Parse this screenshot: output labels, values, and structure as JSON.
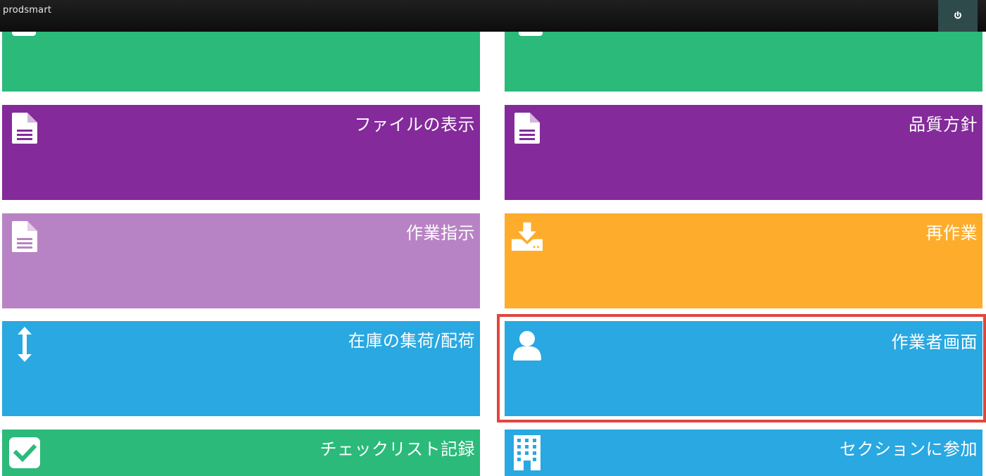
{
  "header": {
    "brand": "prodsmart",
    "power_icon": "power-icon"
  },
  "tiles": [
    {
      "id": "top-left",
      "label": "",
      "color": "#2bba7a",
      "icon": "tile-icon-partial"
    },
    {
      "id": "top-right",
      "label": "",
      "color": "#2bba7a",
      "icon": "tile-icon-partial"
    },
    {
      "id": "view-files",
      "label": "ファイルの表示",
      "color": "#842a9b",
      "icon": "document-icon"
    },
    {
      "id": "quality-policy",
      "label": "品質方針",
      "color": "#842a9b",
      "icon": "document-icon"
    },
    {
      "id": "work-instructions",
      "label": "作業指示",
      "color": "#b883c4",
      "icon": "document-icon"
    },
    {
      "id": "rework",
      "label": "再作業",
      "color": "#fdad2b",
      "icon": "download-tray-icon"
    },
    {
      "id": "stock-picking",
      "label": "在庫の集荷/配荷",
      "color": "#29a8e1",
      "icon": "vertical-arrows-icon"
    },
    {
      "id": "operator-screen",
      "label": "作業者画面",
      "color": "#29a8e1",
      "icon": "user-icon"
    },
    {
      "id": "checklist-record",
      "label": "チェックリスト記録",
      "color": "#2bba7a",
      "icon": "checkbox-icon"
    },
    {
      "id": "join-section",
      "label": "セクションに参加",
      "color": "#29a8e1",
      "icon": "building-icon"
    }
  ]
}
